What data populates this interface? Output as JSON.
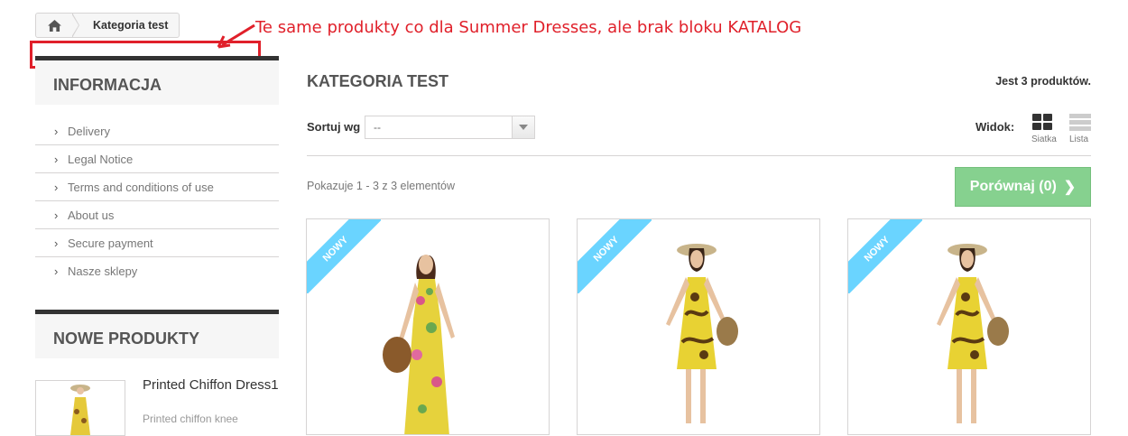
{
  "breadcrumb": {
    "home_icon": "home-icon",
    "current": "Kategoria test"
  },
  "annotation": {
    "text": "Te same produkty co dla Summer Dresses, ale brak bloku KATALOG",
    "color": "#e0202a"
  },
  "sidebar": {
    "info_title": "INFORMACJA",
    "info_items": [
      "Delivery",
      "Legal Notice",
      "Terms and conditions of use",
      "About us",
      "Secure payment",
      "Nasze sklepy"
    ],
    "new_title": "NOWE PRODUKTY",
    "new_product": {
      "name": "Printed Chiffon Dress1",
      "desc": "Printed chiffon knee"
    }
  },
  "main": {
    "title": "KATEGORIA TEST",
    "count": "Jest 3 produktów.",
    "sort_label": "Sortuj wg",
    "sort_value": "--",
    "view_label": "Widok:",
    "grid_label": "Siatka",
    "list_label": "Lista",
    "showing": "Pokazuje 1 - 3 z 3 elementów",
    "compare": "Porównaj (0)",
    "compare_color": "#86d18f",
    "products": [
      {
        "badge": "Nowy",
        "dress": "long-floral"
      },
      {
        "badge": "Nowy",
        "dress": "short-yellow"
      },
      {
        "badge": "Nowy",
        "dress": "short-yellow"
      }
    ]
  }
}
